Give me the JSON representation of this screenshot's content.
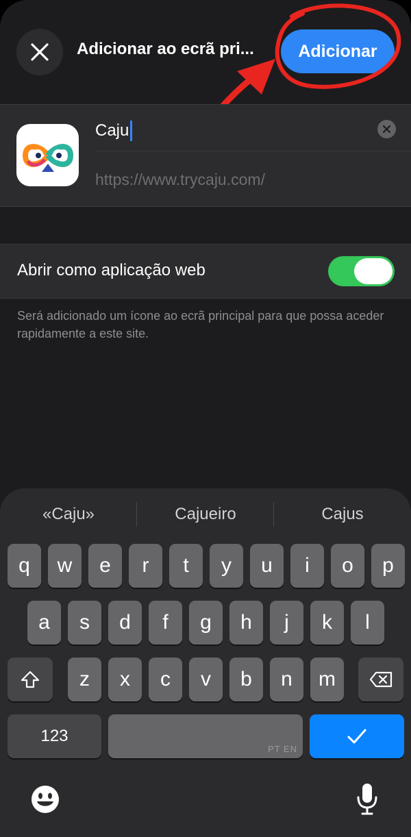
{
  "header": {
    "title": "Adicionar ao ecrã pri...",
    "add_label": "Adicionar",
    "close_icon": "close-icon"
  },
  "card": {
    "name_value": "Caju",
    "url": "https://www.trycaju.com/",
    "clear_icon": "clear-icon"
  },
  "settings": {
    "web_app_label": "Abrir como aplicação web",
    "web_app_enabled": true,
    "toggle_color": "#34c759",
    "footnote": "Será adicionado um ícone ao ecrã principal para que possa aceder rapidamente a este site."
  },
  "keyboard": {
    "suggestions": [
      "«Caju»",
      "Cajueiro",
      "Cajus"
    ],
    "row1": [
      "q",
      "w",
      "e",
      "r",
      "t",
      "y",
      "u",
      "i",
      "o",
      "p"
    ],
    "row2": [
      "a",
      "s",
      "d",
      "f",
      "g",
      "h",
      "j",
      "k",
      "l"
    ],
    "row3": [
      "z",
      "x",
      "c",
      "v",
      "b",
      "n",
      "m"
    ],
    "numbers_label": "123",
    "space_languages": "PT EN",
    "return_icon": "checkmark-icon",
    "return_color": "#0a84ff"
  },
  "colors": {
    "accent": "#2f86f6",
    "annotation": "#e8251f"
  }
}
